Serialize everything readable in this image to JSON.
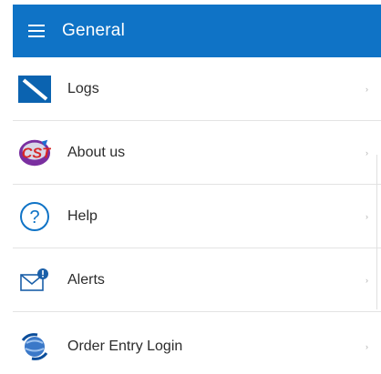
{
  "app_bar": {
    "title": "General",
    "menu_icon": "hamburger-menu-icon",
    "color": "#0f73c6"
  },
  "items": [
    {
      "label": "Logs",
      "icon": "logs-icon",
      "chevron": "›"
    },
    {
      "label": "About us",
      "icon": "company-logo-icon",
      "chevron": "›"
    },
    {
      "label": "Help",
      "icon": "help-icon",
      "chevron": "›"
    },
    {
      "label": "Alerts",
      "icon": "alerts-mail-icon",
      "chevron": "›"
    },
    {
      "label": "Order Entry Login",
      "icon": "order-entry-globe-icon",
      "chevron": "›"
    }
  ]
}
